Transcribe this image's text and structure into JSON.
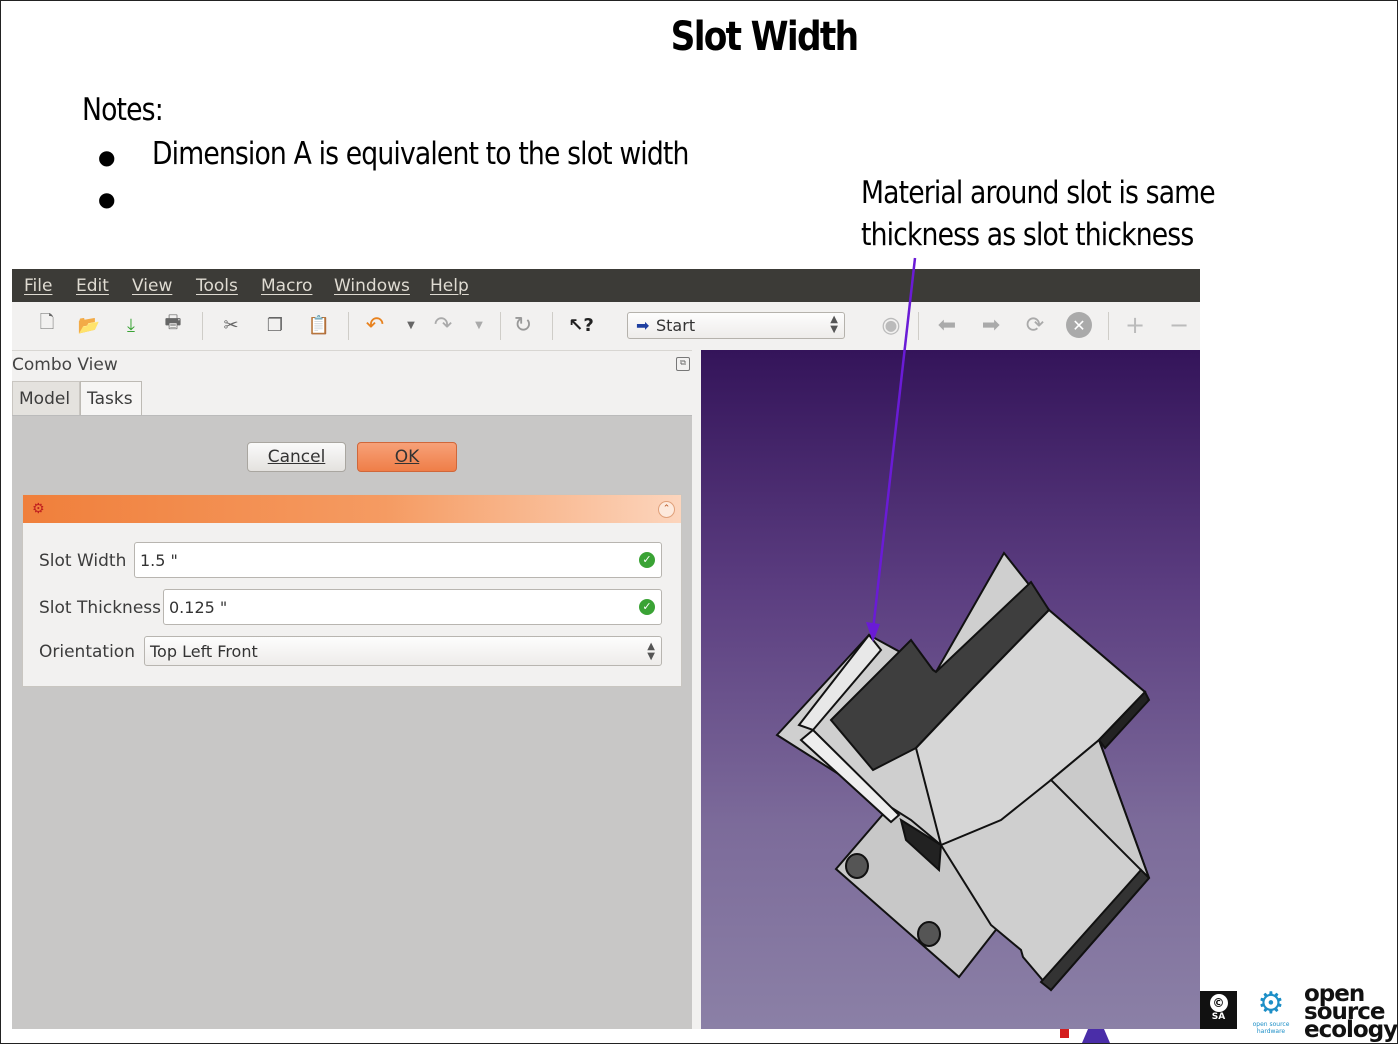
{
  "slide": {
    "title": "Slot Width",
    "notes_label": "Notes:",
    "bullets": [
      "Dimension A is equivalent to the slot width",
      ""
    ],
    "annotation_line1": "Material around slot is same",
    "annotation_line2": "thickness as slot thickness",
    "annotation_arrow_color": "#6a1bd6"
  },
  "app": {
    "menu": {
      "file": "File",
      "edit": "Edit",
      "view": "View",
      "tools": "Tools",
      "macro": "Macro",
      "windows": "Windows",
      "help": "Help"
    },
    "toolbar": {
      "workbench": "Start",
      "icons": [
        "new-document-icon",
        "open-folder-icon",
        "save-icon",
        "print-icon",
        "cut-icon",
        "copy-icon",
        "paste-icon",
        "undo-icon",
        "redo-icon",
        "refresh-icon",
        "whats-this-icon",
        "web-globe-icon",
        "back-icon",
        "forward-icon",
        "reload-icon",
        "stop-icon",
        "zoom-in-icon",
        "zoom-out-icon"
      ]
    },
    "combo_view": {
      "title": "Combo View",
      "tabs": {
        "model": "Model",
        "tasks": "Tasks"
      },
      "buttons": {
        "cancel": "Cancel",
        "ok": "OK"
      },
      "fields": {
        "slot_width_label": "Slot Width",
        "slot_width_value": "1.5 \"",
        "slot_thickness_label": "Slot Thickness",
        "slot_thickness_value": "0.125 \"",
        "orientation_label": "Orientation",
        "orientation_value": "Top Left Front"
      }
    },
    "colors": {
      "menubar": "#3c3b37",
      "task_header_start": "#f07f3b",
      "ok_button": "#ef7e48",
      "viewport_top": "#34145a",
      "viewport_bottom": "#8b80a6",
      "valid_check": "#3aa335"
    }
  },
  "logos": {
    "cc_badge": "SA",
    "osh_line1": "open source",
    "osh_line2": "hardware",
    "ose_line1": "open",
    "ose_line2": "source",
    "ose_line3": "ecology"
  }
}
